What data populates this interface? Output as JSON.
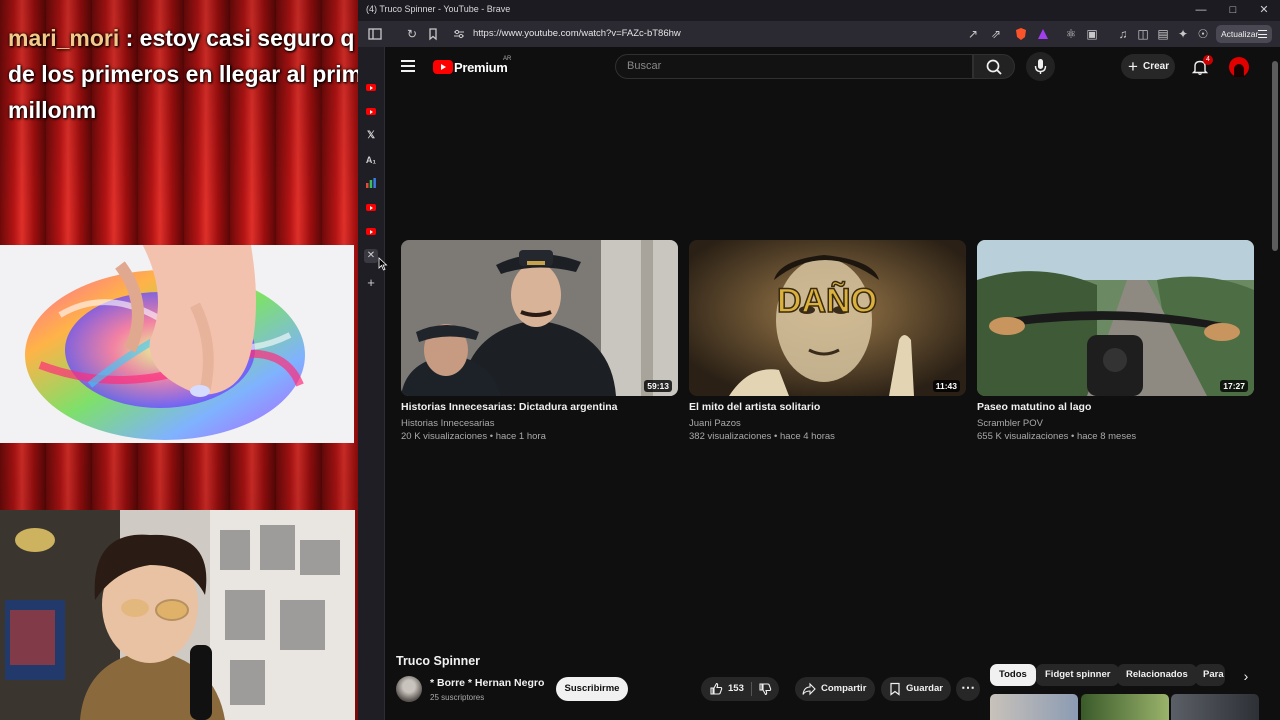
{
  "stream": {
    "chat": {
      "username": "mari_mori",
      "separator": " : ",
      "message": "estoy casi seguro q fue de los primeros en llegar al primer millonm"
    }
  },
  "browser": {
    "window_title": "(4) Truco Spinner - YouTube - Brave",
    "url": "https://www.youtube.com/watch?v=FAZc-bT86hw",
    "update_button": "Actualizar",
    "window_controls": [
      "minimize",
      "maximize",
      "close"
    ]
  },
  "youtube": {
    "logo_text": "Premium",
    "region": "AR",
    "search_placeholder": "Buscar",
    "create_label": "Crear",
    "notification_count": "4",
    "end_screen": [
      {
        "title": "Historias Innecesarias: Dictadura argentina",
        "channel": "Historias Innecesarias",
        "views": "20 K visualizaciones",
        "age": "hace 1 hora",
        "duration": "59:13"
      },
      {
        "title": "El mito del artista solitario",
        "channel": "Juani Pazos",
        "views": "382 visualizaciones",
        "age": "hace 4 horas",
        "duration": "11:43",
        "thumb_text": "DAÑO"
      },
      {
        "title": "Paseo matutino al lago",
        "channel": "Scrambler POV",
        "views": "655 K visualizaciones",
        "age": "hace 8 meses",
        "duration": "17:27"
      }
    ],
    "meta_separator": " • ",
    "video": {
      "title": "Truco Spinner",
      "channel": "* Borre * Hernan Negro",
      "subscribers": "25 suscriptores",
      "subscribe_label": "Suscribirme",
      "likes": "153",
      "share_label": "Compartir",
      "save_label": "Guardar"
    },
    "chips": [
      "Todos",
      "Fidget spinner",
      "Relacionados",
      "Para"
    ]
  },
  "colors": {
    "yt_red": "#ff0000",
    "page_bg": "#0f0f0f",
    "chip_active": "#f1f1f1"
  }
}
